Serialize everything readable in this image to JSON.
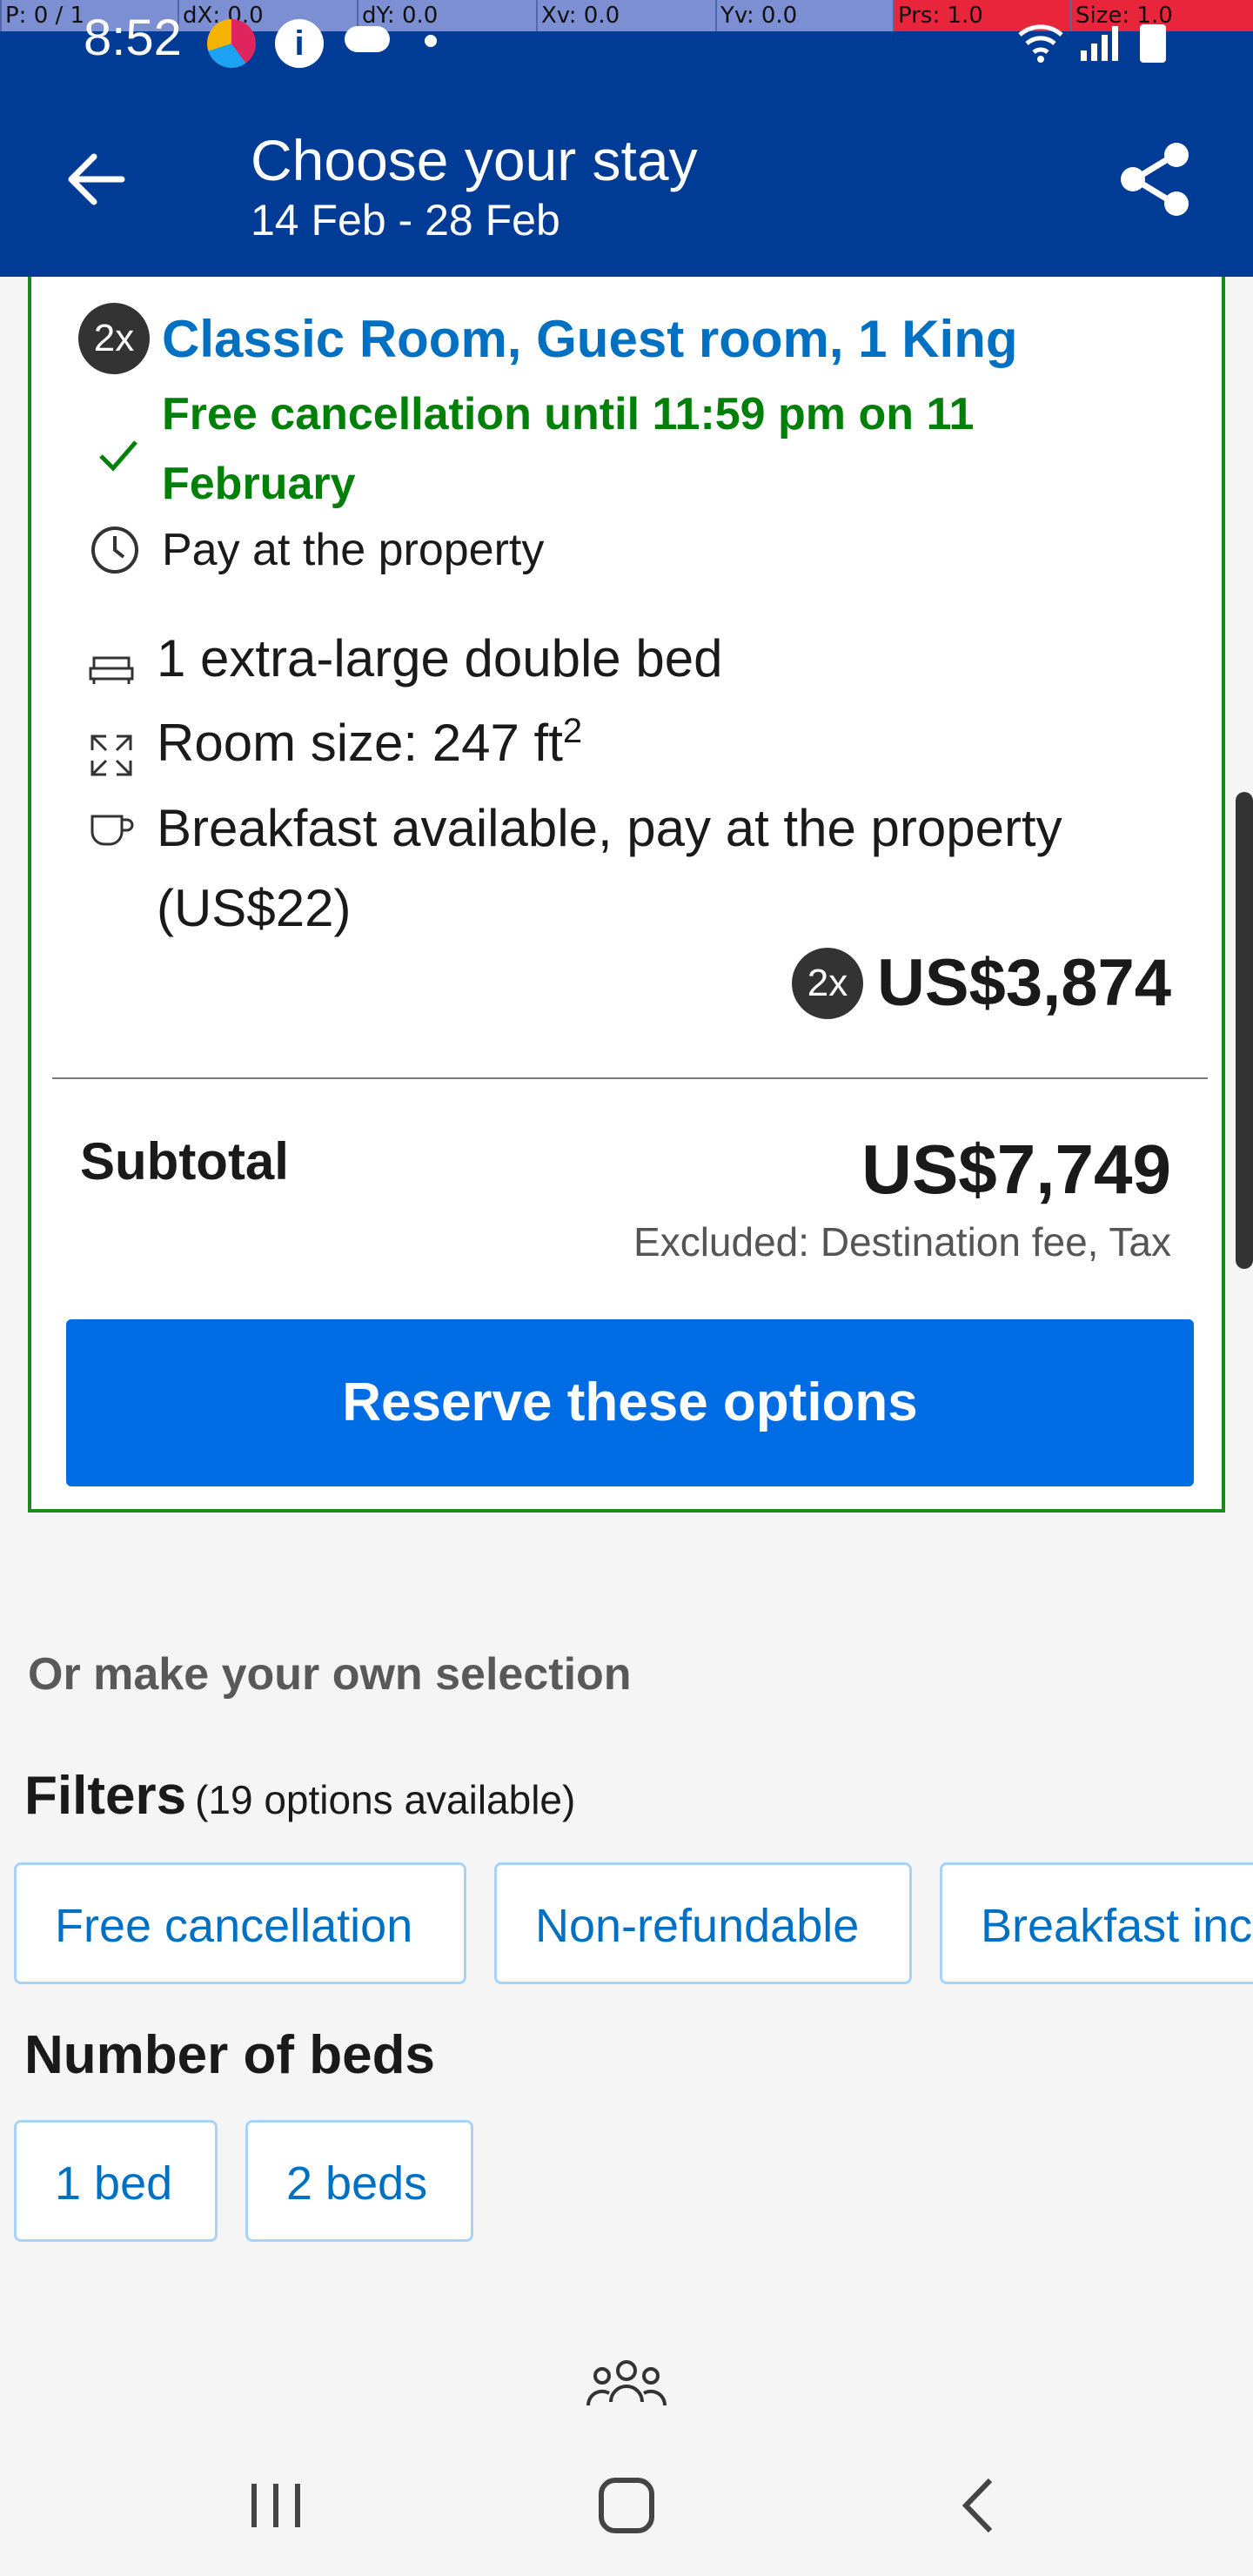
{
  "debug_bar": {
    "p": "P: 0 / 1",
    "dx": "dX: 0.0",
    "dy": "dY: 0.0",
    "xv": "Xv: 0.0",
    "yv": "Yv: 0.0",
    "prs": "Prs: 1.0",
    "size": "Size: 1.0"
  },
  "status_bar": {
    "time": "8:52"
  },
  "header": {
    "title": "Choose your stay",
    "dates": "14 Feb - 28 Feb"
  },
  "room": {
    "quantity_badge": "2x",
    "name": "Classic Room, Guest room, 1 King",
    "cancellation": "Free cancellation until 11:59 pm on 11 February",
    "payment": "Pay at the property",
    "bed": "1 extra-large double bed",
    "size_prefix": "Room size: 247 ft",
    "size_sup": "2",
    "breakfast": "Breakfast available, pay at the property (US$22)",
    "price_badge": "2x",
    "price": "US$3,874"
  },
  "summary": {
    "subtotal_label": "Subtotal",
    "subtotal_amount": "US$7,749",
    "excluded": "Excluded: Destination fee, Tax",
    "reserve_label": "Reserve these options"
  },
  "selection": {
    "heading": "Or make your own selection",
    "filters_label": "Filters",
    "filters_count": "(19 options available)",
    "filter_chips": [
      "Free cancellation",
      "Non-refundable",
      "Breakfast inc"
    ],
    "beds_heading": "Number of beds",
    "bed_chips": [
      "1 bed",
      "2 beds"
    ]
  },
  "colors": {
    "header_bg": "#003b95",
    "link_blue": "#0071c2",
    "button_blue": "#006ce4",
    "green": "#008009"
  }
}
